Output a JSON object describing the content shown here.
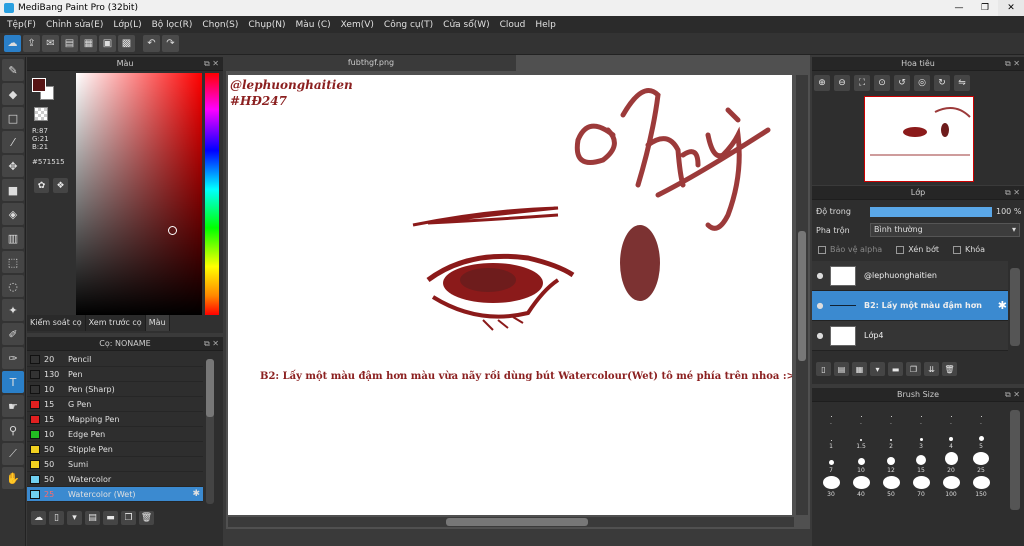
{
  "window": {
    "title": "MediBang Paint Pro (32bit)",
    "minimize": "—",
    "maximize": "❐",
    "close": "✕"
  },
  "menu": [
    "Tệp(F)",
    "Chỉnh sửa(E)",
    "Lớp(L)",
    "Bộ lọc(R)",
    "Chọn(S)",
    "Chụp(N)",
    "Màu (C)",
    "Xem(V)",
    "Công cụ(T)",
    "Cửa sổ(W)",
    "Cloud",
    "Help"
  ],
  "color_panel": {
    "title": "Màu",
    "r": "R:87",
    "g": "G:21",
    "b": "B:21",
    "hex": "#571515",
    "main_color": "#571515",
    "tabs": [
      "Kiểm soát cọ",
      "Xem trước cọ",
      "Màu"
    ]
  },
  "brush_panel": {
    "title": "Cọ: NONAME",
    "items": [
      {
        "size": "20",
        "name": "Pencil",
        "color": "#333333"
      },
      {
        "size": "130",
        "name": "Pen",
        "color": "#333333"
      },
      {
        "size": "10",
        "name": "Pen (Sharp)",
        "color": "#333333"
      },
      {
        "size": "15",
        "name": "G Pen",
        "color": "#e02020"
      },
      {
        "size": "15",
        "name": "Mapping Pen",
        "color": "#e02020"
      },
      {
        "size": "10",
        "name": "Edge Pen",
        "color": "#22bb22"
      },
      {
        "size": "50",
        "name": "Stipple Pen",
        "color": "#f0d020"
      },
      {
        "size": "50",
        "name": "Sumi",
        "color": "#f0d020"
      },
      {
        "size": "50",
        "name": "Watercolor",
        "color": "#70d0f0"
      },
      {
        "size": "25",
        "name": "Watercolor (Wet)",
        "color": "#70d0f0"
      }
    ],
    "selected_index": 9
  },
  "canvas": {
    "tab_title": "fubthgf.png",
    "watermark_line1": "@lephuonghaitien",
    "watermark_line2": "#HĐ247",
    "signature": "@thuỳ",
    "instruction": "B2: Lấy một màu đậm hơn màu vừa nãy rồi dùng bút Watercolour(Wet) tô mé phía trên nhoa :>>"
  },
  "navigator": {
    "title": "Hoa tiêu"
  },
  "layer_panel": {
    "title": "Lớp",
    "opacity_label": "Độ trong",
    "opacity_value": "100 %",
    "opacity": 1.0,
    "blend_label": "Pha trộn",
    "blend_value": "Bình thường",
    "protect_alpha": "Bảo vệ alpha",
    "clipping": "Xén bớt",
    "lock": "Khóa",
    "layers": [
      {
        "name": "@lephuonghaitien"
      },
      {
        "name": "B2: Lấy một màu đậm hơn"
      },
      {
        "name": "Lớp4"
      }
    ]
  },
  "brush_size": {
    "title": "Brush Size",
    "sizes": [
      ".",
      ".",
      ".",
      ".",
      ".",
      ".",
      "1",
      "1.5",
      "2",
      "3",
      "4",
      "5",
      "7",
      "10",
      "12",
      "15",
      "20",
      "25",
      "30",
      "40",
      "50",
      "70",
      "100",
      "150"
    ]
  }
}
